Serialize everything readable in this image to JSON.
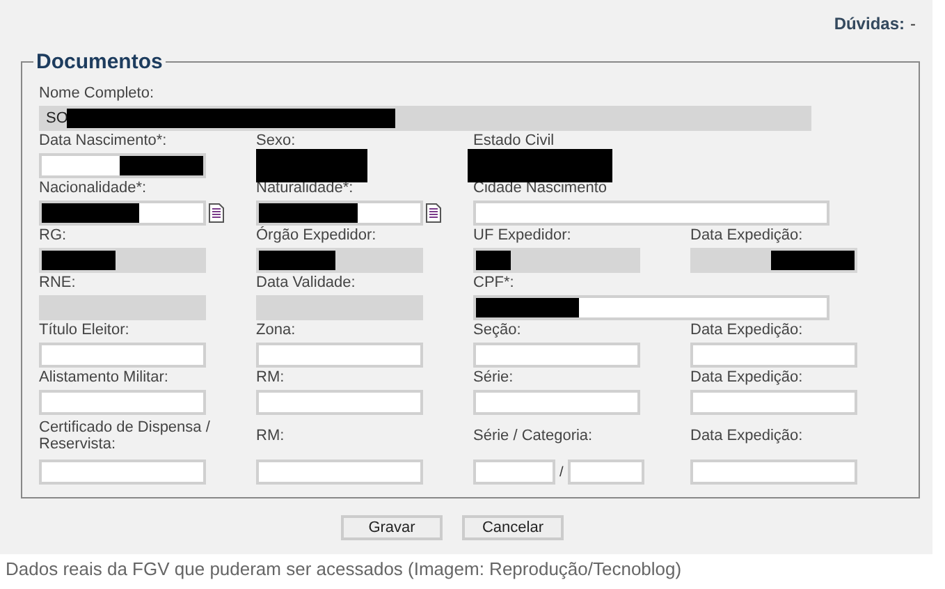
{
  "help": {
    "label": "Dúvidas:",
    "value": "-"
  },
  "section": {
    "title": "Documentos",
    "rows": [
      [
        {
          "label": "Nome Completo:",
          "kind": "readonly",
          "value": "SO",
          "redacted": true,
          "wide": true
        }
      ],
      [
        {
          "label": "Data Nascimento*:",
          "kind": "input",
          "redacted": true
        },
        {
          "label": "Sexo:",
          "kind": "hidden",
          "redacted": true
        },
        {
          "label": "Estado Civil",
          "kind": "hidden",
          "redacted": true
        }
      ],
      [
        {
          "label": "Nacionalidade*:",
          "kind": "input",
          "redacted": true,
          "lookup": true
        },
        {
          "label": "Naturalidade*:",
          "kind": "input",
          "redacted": true,
          "lookup": true
        },
        {
          "label": "Cidade Nascimento",
          "kind": "input",
          "wide": true
        }
      ],
      [
        {
          "label": "RG:",
          "kind": "readonly",
          "redacted": true
        },
        {
          "label": "Órgão Expedidor:",
          "kind": "readonly",
          "redacted": true
        },
        {
          "label": "UF Expedidor:",
          "kind": "readonly",
          "redacted": true
        },
        {
          "label": "Data Expedição:",
          "kind": "readonly",
          "redacted": true
        }
      ],
      [
        {
          "label": "RNE:",
          "kind": "readonly"
        },
        {
          "label": "Data Validade:",
          "kind": "readonly"
        },
        {
          "label": "CPF*:",
          "kind": "input",
          "redacted": true,
          "wide": true
        }
      ],
      [
        {
          "label": "Título Eleitor:",
          "kind": "input"
        },
        {
          "label": "Zona:",
          "kind": "input"
        },
        {
          "label": "Seção:",
          "kind": "input"
        },
        {
          "label": "Data Expedição:",
          "kind": "input"
        }
      ],
      [
        {
          "label": "Alistamento Militar:",
          "kind": "input"
        },
        {
          "label": "RM:",
          "kind": "input"
        },
        {
          "label": "Série:",
          "kind": "input"
        },
        {
          "label": "Data Expedição:",
          "kind": "input"
        }
      ],
      [
        {
          "label": "Certificado de Dispensa / Reservista:",
          "kind": "input"
        },
        {
          "label": "RM:",
          "kind": "input"
        },
        {
          "label": "Série / Categoria:",
          "kind": "pair",
          "separator": "/"
        },
        {
          "label": "Data Expedição:",
          "kind": "input"
        }
      ]
    ]
  },
  "buttons": [
    "Gravar",
    "Cancelar"
  ],
  "caption": "Dados reais da FGV que puderam ser acessados (Imagem: Reprodução/Tecnoblog)"
}
